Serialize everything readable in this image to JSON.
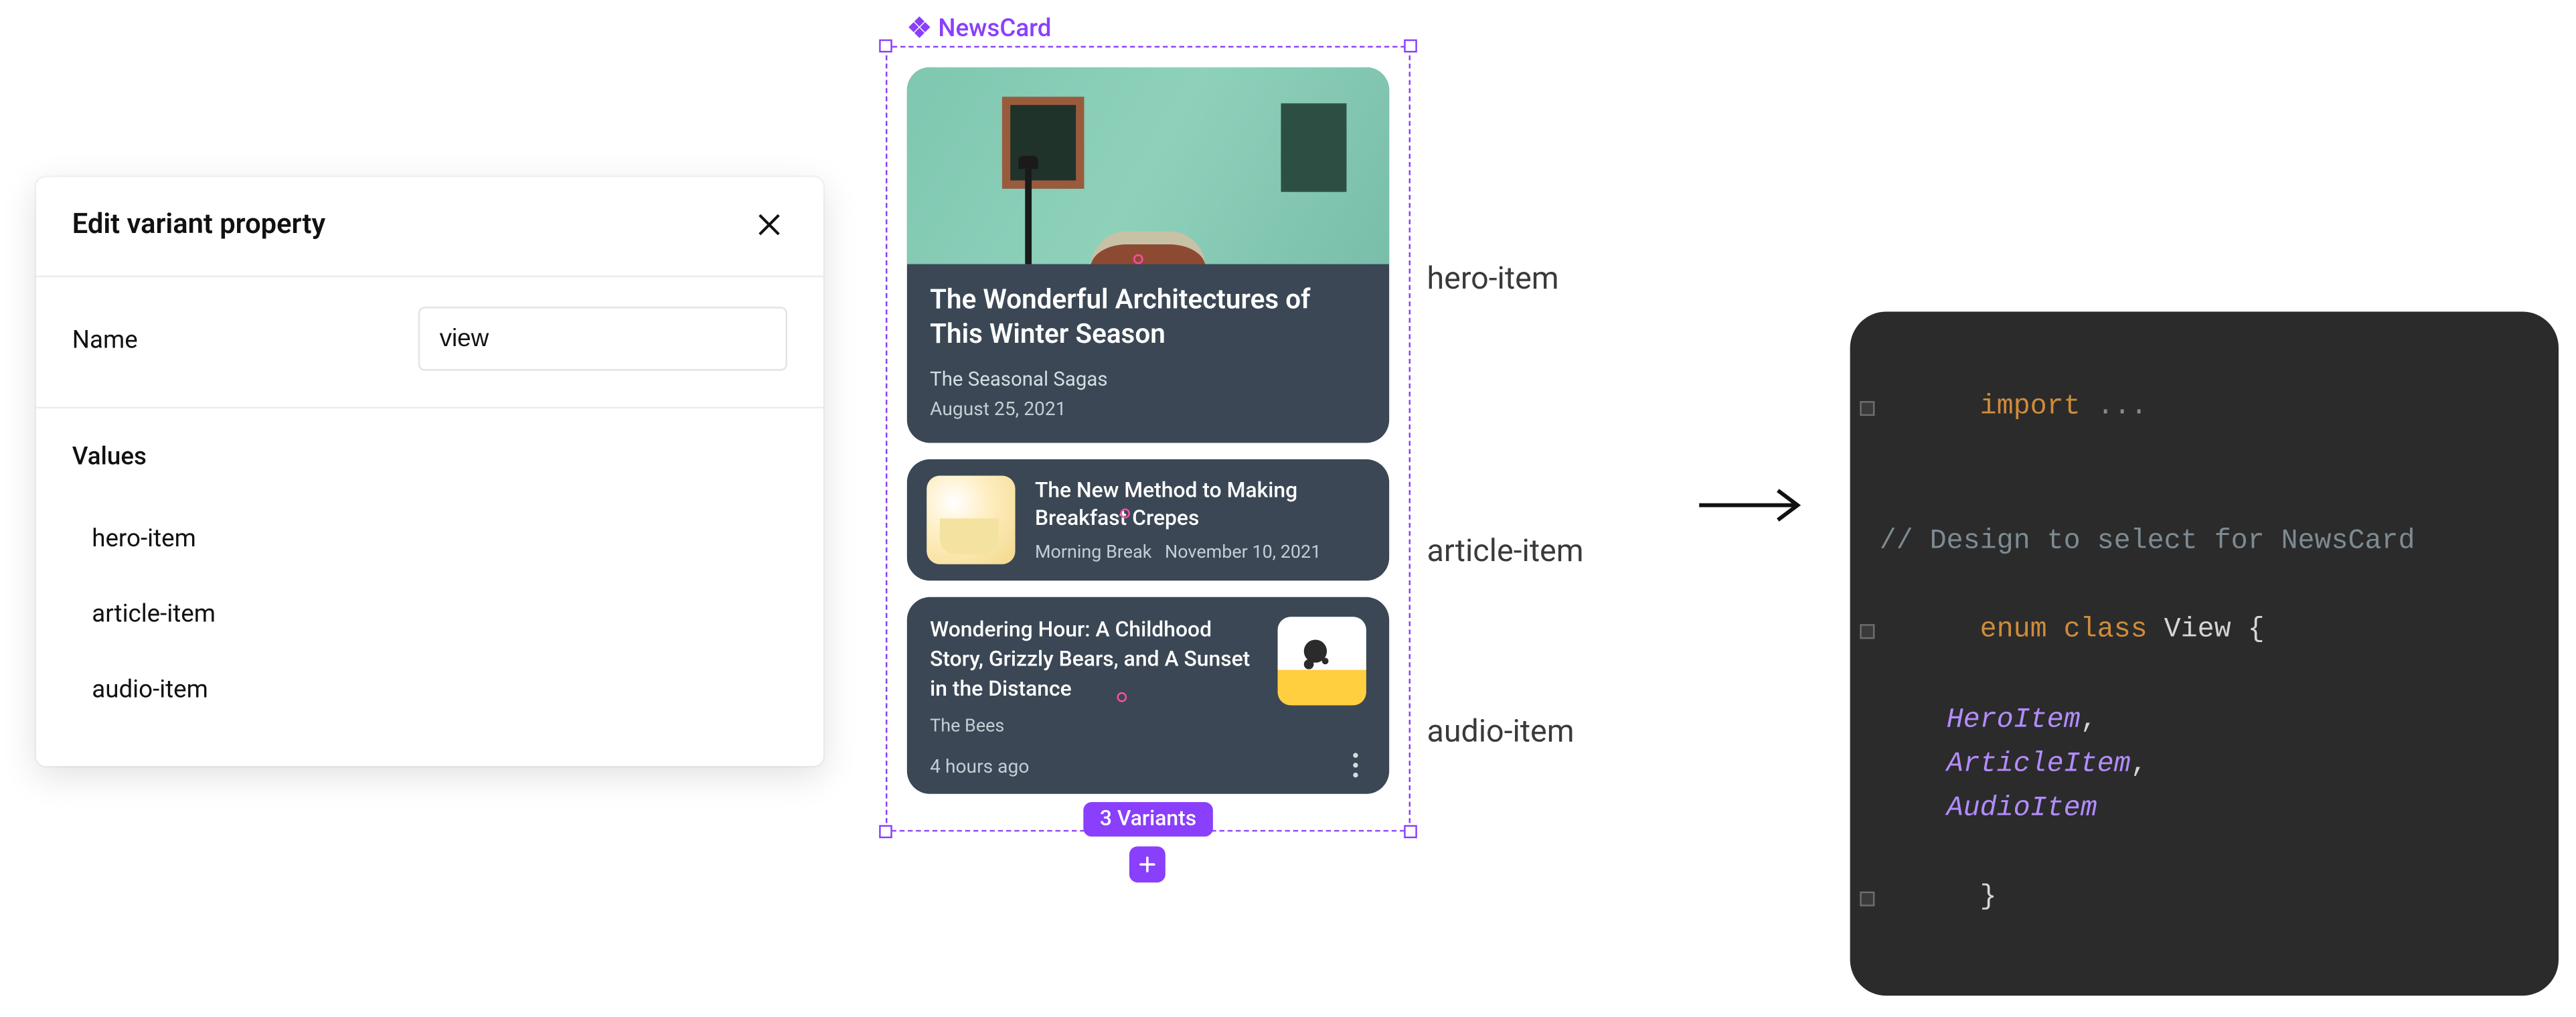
{
  "panel": {
    "title": "Edit variant property",
    "name_label": "Name",
    "name_value": "view",
    "values_heading": "Values",
    "values": [
      "hero-item",
      "article-item",
      "audio-item"
    ]
  },
  "component": {
    "name": "NewsCard",
    "variants_badge": "3 Variants"
  },
  "hero": {
    "title": "The Wonderful Architectures of This Winter Season",
    "subtitle": "The Seasonal Sagas",
    "date": "August 25, 2021",
    "label": "hero-item"
  },
  "article": {
    "title": "The New Method to Making Breakfast Crepes",
    "source": "Morning Break",
    "date": "November 10, 2021",
    "label": "article-item"
  },
  "audio": {
    "title": "Wondering Hour: A Childhood Story, Grizzly Bears, and A Sunset in the Distance",
    "author": "The Bees",
    "time": "4 hours ago",
    "label": "audio-item"
  },
  "code": {
    "import_kw": "import",
    "import_rest": " ...",
    "comment": "// Design to select for NewsCard",
    "enum_kw": "enum",
    "class_kw": "class",
    "type_name": "View",
    "open_brace": " {",
    "members": [
      "HeroItem",
      "ArticleItem",
      "AudioItem"
    ],
    "close_brace": "}"
  }
}
